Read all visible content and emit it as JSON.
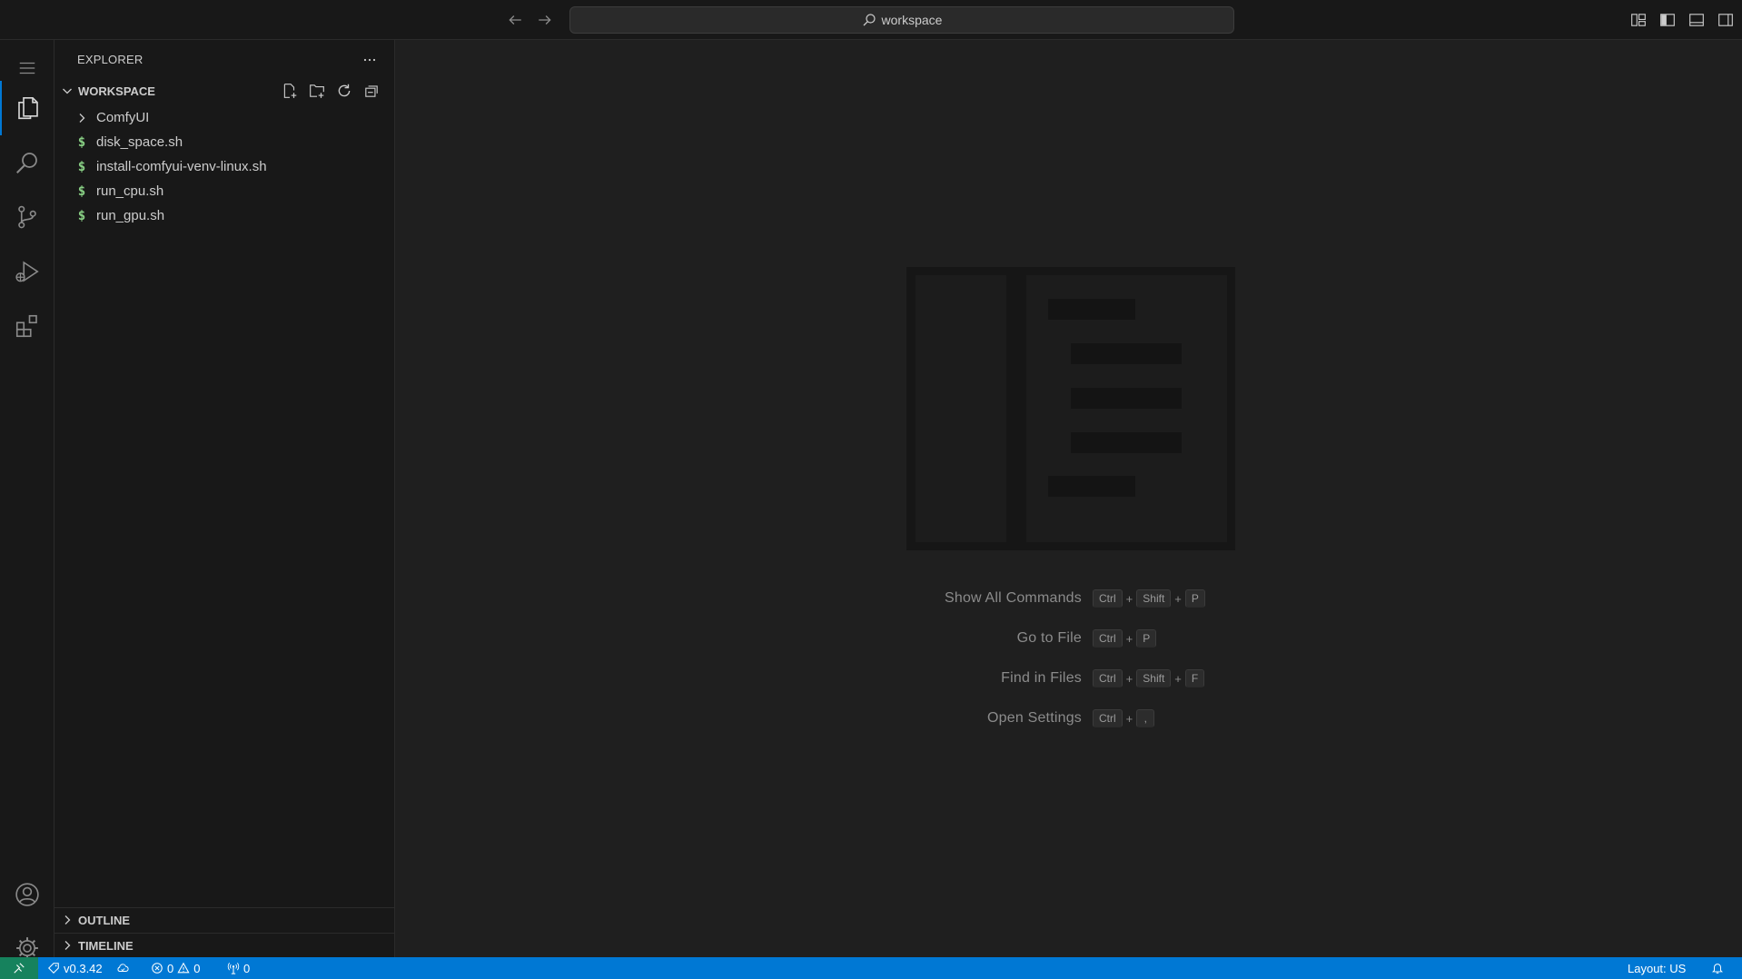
{
  "titlebar": {
    "search_text": "workspace"
  },
  "sidebar": {
    "title": "EXPLORER",
    "workspace_label": "WORKSPACE",
    "tree": [
      {
        "name": "ComfyUI",
        "type": "folder"
      },
      {
        "name": "disk_space.sh",
        "type": "shell"
      },
      {
        "name": "install-comfyui-venv-linux.sh",
        "type": "shell"
      },
      {
        "name": "run_cpu.sh",
        "type": "shell"
      },
      {
        "name": "run_gpu.sh",
        "type": "shell"
      }
    ],
    "outline_label": "OUTLINE",
    "timeline_label": "TIMELINE"
  },
  "editor": {
    "shortcuts": [
      {
        "label": "Show All Commands",
        "keys": [
          "Ctrl",
          "Shift",
          "P"
        ]
      },
      {
        "label": "Go to File",
        "keys": [
          "Ctrl",
          "P"
        ]
      },
      {
        "label": "Find in Files",
        "keys": [
          "Ctrl",
          "Shift",
          "F"
        ]
      },
      {
        "label": "Open Settings",
        "keys": [
          "Ctrl",
          ","
        ]
      }
    ]
  },
  "statusbar": {
    "version": "v0.3.42",
    "errors": "0",
    "warnings": "0",
    "ports": "0",
    "layout": "Layout: US"
  },
  "colors": {
    "accent": "#0078d4",
    "remote": "#16825d",
    "shell_icon": "#89d185"
  }
}
